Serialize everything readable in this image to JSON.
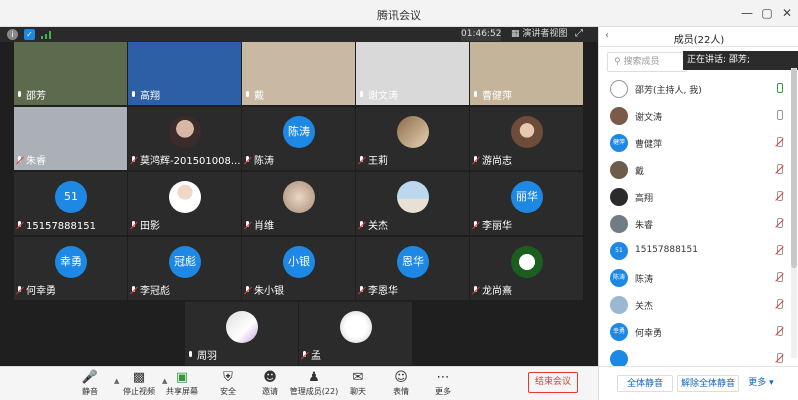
{
  "window": {
    "title": "腾讯会议"
  },
  "stage": {
    "timer": "01:46:52",
    "view_label": "演讲者视图",
    "tiles": [
      {
        "name": "邵芳",
        "kind": "video",
        "bg": "#5c6b4e",
        "muted": false
      },
      {
        "name": "高翔",
        "kind": "video",
        "bg": "#2d5fa6",
        "muted": false
      },
      {
        "name": "戴",
        "kind": "video",
        "bg": "#c9b9a3",
        "muted": false
      },
      {
        "name": "谢文涛",
        "kind": "video",
        "bg": "#d9d9d9",
        "muted": false
      },
      {
        "name": "曹健萍",
        "kind": "video",
        "bg": "#c3b49a",
        "muted": false
      },
      {
        "name": "朱睿",
        "kind": "video",
        "bg": "#aab0b5",
        "muted": true
      },
      {
        "name": "莫鸿辉-201501008...",
        "kind": "avatar",
        "bubble": "",
        "img": "portrait",
        "muted": true
      },
      {
        "name": "陈涛",
        "kind": "avatar",
        "bubble": "陈涛",
        "muted": true
      },
      {
        "name": "王莉",
        "kind": "avatar",
        "bubble": "",
        "img": "room",
        "muted": true
      },
      {
        "name": "游尚志",
        "kind": "avatar",
        "bubble": "",
        "img": "lady",
        "muted": true
      },
      {
        "name": "15157888151",
        "kind": "avatar",
        "bubble": "51",
        "muted": true
      },
      {
        "name": "田影",
        "kind": "avatar",
        "bubble": "",
        "img": "girl",
        "muted": true
      },
      {
        "name": "肖维",
        "kind": "avatar",
        "bubble": "",
        "img": "blur",
        "muted": true
      },
      {
        "name": "关杰",
        "kind": "avatar",
        "bubble": "",
        "img": "sea",
        "muted": true
      },
      {
        "name": "李丽华",
        "kind": "avatar",
        "bubble": "丽华",
        "muted": true
      },
      {
        "name": "何幸勇",
        "kind": "avatar",
        "bubble": "幸勇",
        "muted": true
      },
      {
        "name": "李冠彪",
        "kind": "avatar",
        "bubble": "冠彪",
        "muted": true
      },
      {
        "name": "朱小银",
        "kind": "avatar",
        "bubble": "小银",
        "muted": true
      },
      {
        "name": "李恩华",
        "kind": "avatar",
        "bubble": "恩华",
        "muted": true
      },
      {
        "name": "龙尚熹",
        "kind": "avatar",
        "bubble": "",
        "img": "panda",
        "muted": true
      },
      {
        "name": "周羽",
        "kind": "avatar",
        "bubble": "",
        "img": "card",
        "muted": false
      },
      {
        "name": "孟",
        "kind": "avatar",
        "bubble": "",
        "img": "white",
        "muted": true
      }
    ]
  },
  "toolbar": {
    "mute": "静音",
    "stop_video": "停止视频",
    "share_screen": "共享屏幕",
    "security": "安全",
    "invite": "邀请",
    "manage_members": "管理成员(22)",
    "chat": "聊天",
    "reactions": "表情",
    "more": "更多",
    "end_meeting": "结束会议"
  },
  "panel": {
    "title": "成员(22人)",
    "search_placeholder": "搜索成员",
    "speaking": "正在讲话: 邵芳;",
    "members": [
      {
        "name": "邵芳(主持人, 我)",
        "avatar": "",
        "mic": "on"
      },
      {
        "name": "谢文涛",
        "avatar": "",
        "mic": "plain"
      },
      {
        "name": "曹健萍",
        "avatar": "健萍",
        "mic": "off"
      },
      {
        "name": "戴",
        "avatar": "",
        "mic": "off"
      },
      {
        "name": "高翔",
        "avatar": "",
        "mic": "off"
      },
      {
        "name": "朱睿",
        "avatar": "",
        "mic": "off"
      },
      {
        "name": "15157888151",
        "avatar": "51",
        "mic": "off"
      },
      {
        "name": "陈涛",
        "avatar": "陈涛",
        "mic": "off"
      },
      {
        "name": "关杰",
        "avatar": "",
        "mic": "off"
      },
      {
        "name": "何幸勇",
        "avatar": "幸勇",
        "mic": "off"
      },
      {
        "name": "",
        "avatar": "",
        "mic": "off"
      }
    ],
    "mute_all": "全体静音",
    "unmute_all": "解除全体静音",
    "more": "更多"
  }
}
